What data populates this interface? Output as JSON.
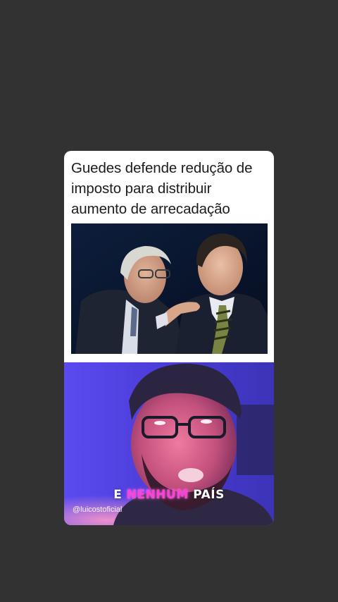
{
  "background_color": "#323232",
  "news_card": {
    "headline": "Guedes defende redução de imposto para distribuir aumento de arrecadação",
    "photo": "news-photo-two-men-suits"
  },
  "video": {
    "caption_before": "E",
    "caption_highlight": "NENHUM",
    "caption_after": "PAÍS",
    "highlight_color": "#ff3fd9",
    "watermark": "@luicostoficial",
    "background_color": "#4b3fd8"
  }
}
